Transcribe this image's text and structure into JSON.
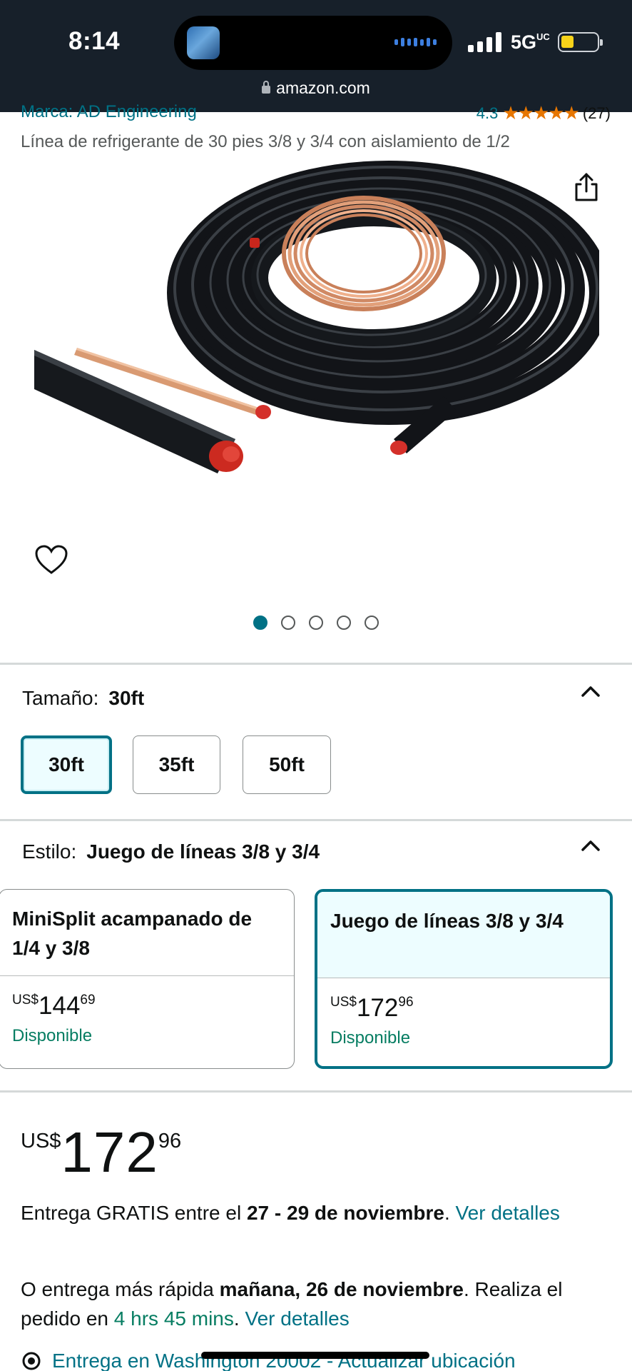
{
  "status_bar": {
    "time": "8:14",
    "network": "5G",
    "network_suffix": "UC",
    "url": "amazon.com"
  },
  "product": {
    "brand": "Marca: AD Engineering",
    "rating": "4.3",
    "stars": "★★★★★",
    "rating_count": "(27)",
    "title": "Línea de refrigerante de 30 pies 3/8 y 3/4 con aislamiento de 1/2",
    "image_count": 5,
    "active_image_index": 0
  },
  "size": {
    "label": "Tamaño:",
    "selected": "30ft",
    "options": [
      "30ft",
      "35ft",
      "50ft"
    ]
  },
  "style": {
    "label": "Estilo:",
    "selected": "Juego de líneas 3/8 y 3/4",
    "options": [
      {
        "name": "MiniSplit acampanado de 1/4 y 3/8",
        "currency": "US$",
        "whole": "144",
        "fraction": "69",
        "availability": "Disponible"
      },
      {
        "name": "Juego de líneas 3/8 y 3/4",
        "currency": "US$",
        "whole": "172",
        "fraction": "96",
        "availability": "Disponible"
      }
    ]
  },
  "price": {
    "currency": "US$",
    "whole": "172",
    "fraction": "96"
  },
  "delivery": {
    "free_prefix": "Entrega GRATIS entre el ",
    "free_dates": "27 - 29 de noviembre",
    "free_period": ". ",
    "free_link": "Ver detalles",
    "fast_prefix": "O entrega más rápida ",
    "fast_date": "mañana, 26 de noviembre",
    "fast_mid": ". Realiza el pedido en ",
    "fast_time": "4 hrs 45 mins",
    "fast_period": ". ",
    "fast_link": "Ver detalles",
    "location_text": "Entrega en Washington 20002 - Actualizar ubicación"
  },
  "colors": {
    "accent": "#007185",
    "available_green": "#067d62",
    "star_orange": "#e77600",
    "status_bar_bg": "#17202a"
  },
  "icons": [
    "lock-icon",
    "share-icon",
    "heart-icon",
    "chevron-up-icon",
    "location-pin-icon"
  ]
}
